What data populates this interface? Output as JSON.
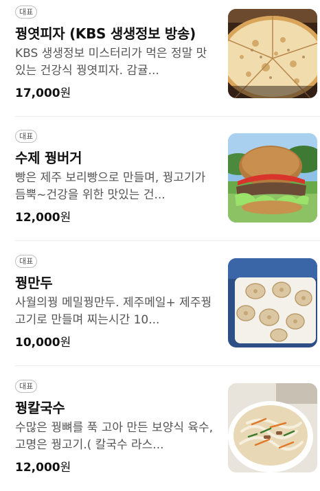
{
  "menu": {
    "items": [
      {
        "badge": "대표",
        "name": "꿩엿피자 (KBS 생생정보 방송)",
        "description": "KBS 생생정보 미스터리가 먹은 정말 맛있는 건강식 꿩엿피자. 감귤...",
        "price": "17,000",
        "currency": "원",
        "image_icon": "pizza-photo"
      },
      {
        "badge": "대표",
        "name": "수제 꿩버거",
        "description": "빵은 제주 보리빵으로 만들며, 꿩고기가 듬뿍~건강을 위한 맛있는 건...",
        "price": "12,000",
        "currency": "원",
        "image_icon": "burger-photo"
      },
      {
        "badge": "대표",
        "name": "꿩만두",
        "description": "사월의꿩 메밀꿩만두. 제주메일+ 제주꿩고기로 만들며 찌는시간 10...",
        "price": "10,000",
        "currency": "원",
        "image_icon": "dumplings-photo"
      },
      {
        "badge": "대표",
        "name": "꿩칼국수",
        "description": "수많은 꿩뼈를 푹 고아 만든 보양식 육수,고명은 꿩고기.( 칼국수 라스...",
        "price": "12,000",
        "currency": "원",
        "image_icon": "noodle-soup-photo"
      }
    ]
  }
}
